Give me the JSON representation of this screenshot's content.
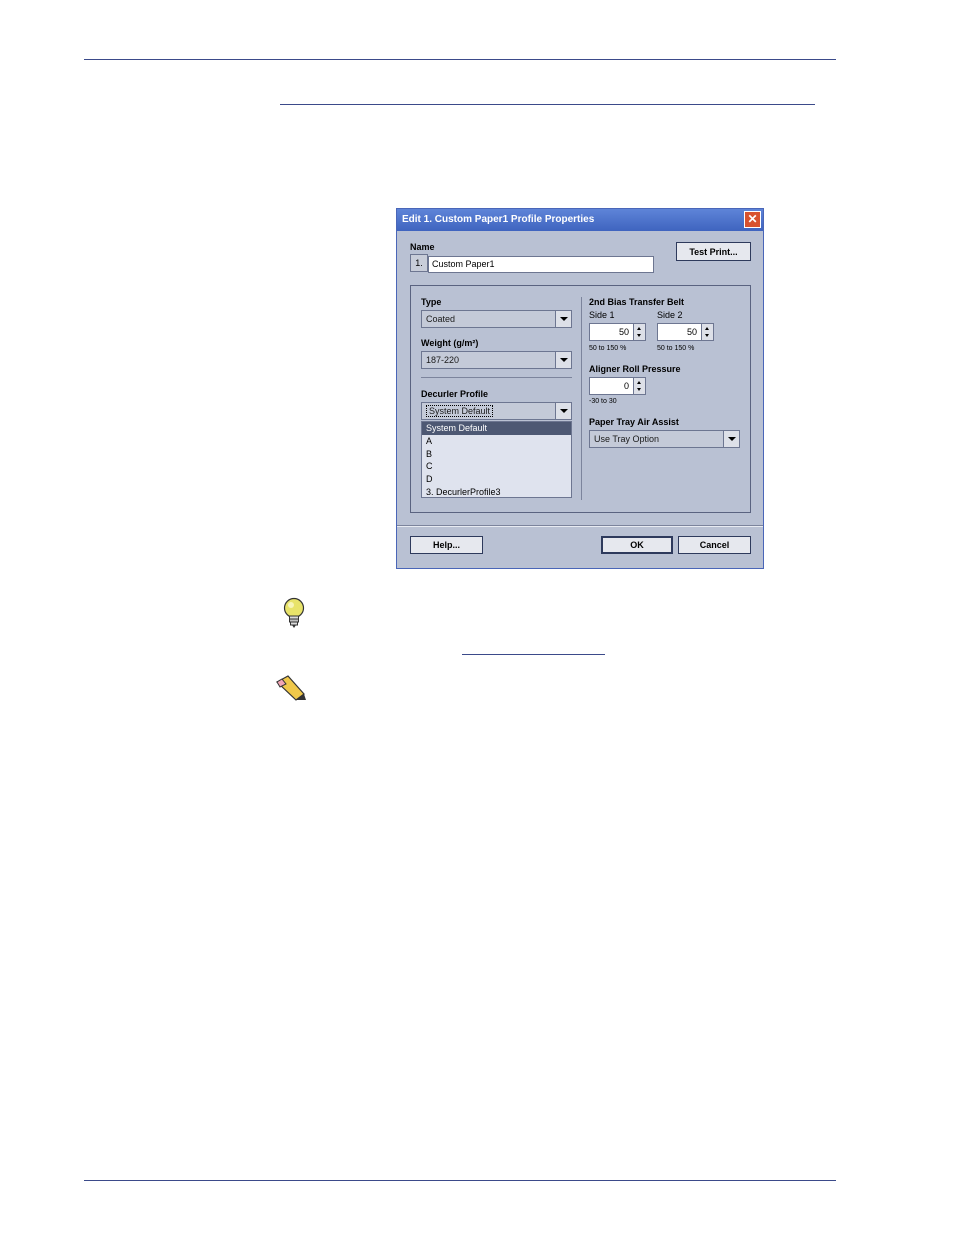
{
  "dialog": {
    "title": "Edit 1. Custom Paper1 Profile Properties",
    "name_label": "Name",
    "name_number": "1.",
    "name_value": "Custom Paper1",
    "test_print_label": "Test Print...",
    "type_label": "Type",
    "type_value": "Coated",
    "weight_label": "Weight (g/m²)",
    "weight_value": "187-220",
    "decurler_label": "Decurler Profile",
    "decurler_value": "System Default",
    "decurler_options": [
      "System Default",
      "A",
      "B",
      "C",
      "D",
      "3. DecurlerProfile3"
    ],
    "bias_label": "2nd Bias Transfer Belt",
    "side1_label": "Side 1",
    "side1_value": "50",
    "side1_range": "50 to 150 %",
    "side2_label": "Side 2",
    "side2_value": "50",
    "side2_range": "50 to 150 %",
    "aligner_label": "Aligner Roll Pressure",
    "aligner_value": "0",
    "aligner_range": "-30 to 30",
    "air_assist_label": "Paper Tray Air Assist",
    "air_assist_value": "Use Tray Option",
    "help_label": "Help...",
    "ok_label": "OK",
    "cancel_label": "Cancel"
  },
  "icons": {
    "tip": "lightbulb-icon",
    "note": "pencil-note-icon"
  },
  "colors": {
    "rule": "#3b4a8a",
    "titlebar": "#3f64bf",
    "dialog_bg": "#b9c1d3",
    "selected_item": "#4d5873"
  }
}
